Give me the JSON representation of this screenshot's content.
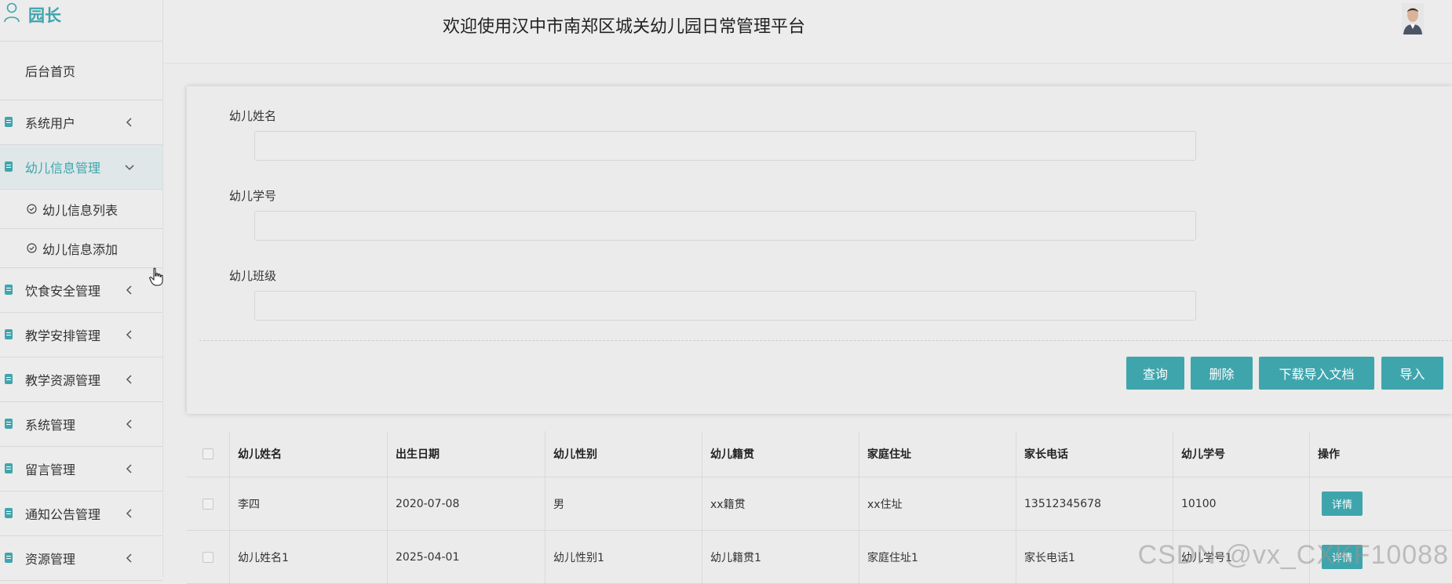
{
  "sidebar": {
    "brand": "园长",
    "home": "后台首页",
    "items": [
      {
        "label": "系统用户"
      },
      {
        "label": "幼儿信息管理"
      },
      {
        "label": "饮食安全管理"
      },
      {
        "label": "教学安排管理"
      },
      {
        "label": "教学资源管理"
      },
      {
        "label": "系统管理"
      },
      {
        "label": "留言管理"
      },
      {
        "label": "通知公告管理"
      },
      {
        "label": "资源管理"
      }
    ],
    "sub_items": [
      {
        "label": "幼儿信息列表"
      },
      {
        "label": "幼儿信息添加"
      }
    ]
  },
  "header": {
    "title": "欢迎使用汉中市南郑区城关幼儿园日常管理平台"
  },
  "form": {
    "fields": [
      {
        "label": "幼儿姓名",
        "value": ""
      },
      {
        "label": "幼儿学号",
        "value": ""
      },
      {
        "label": "幼儿班级",
        "value": ""
      }
    ],
    "buttons": {
      "query": "查询",
      "delete": "删除",
      "download": "下载导入文档",
      "import": "导入"
    }
  },
  "table": {
    "columns": [
      "幼儿姓名",
      "出生日期",
      "幼儿性别",
      "幼儿籍贯",
      "家庭住址",
      "家长电话",
      "幼儿学号",
      "操作"
    ],
    "rows": [
      [
        "李四",
        "2020-07-08",
        "男",
        "xx籍贯",
        "xx住址",
        "13512345678",
        "10100",
        "详情"
      ],
      [
        "幼儿姓名1",
        "2025-04-01",
        "幼儿性别1",
        "幼儿籍贯1",
        "家庭住址1",
        "家长电话1",
        "幼儿学号1",
        "详情"
      ]
    ]
  },
  "watermark": "CSDN @vx_CXKF10088",
  "colors": {
    "accent": "#3fa5ad",
    "background": "#ebebeb"
  }
}
